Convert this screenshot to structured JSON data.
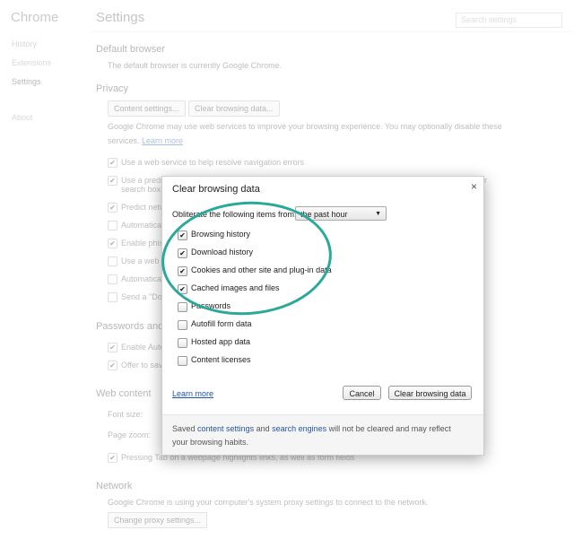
{
  "app": {
    "brand": "Chrome",
    "page_title": "Settings"
  },
  "sidebar": {
    "items": [
      {
        "label": "History"
      },
      {
        "label": "Extensions"
      },
      {
        "label": "Settings",
        "active": true
      },
      {
        "label": "About"
      }
    ]
  },
  "search": {
    "placeholder": "Search settings"
  },
  "sections": {
    "default_browser": {
      "heading": "Default browser",
      "text": "The default browser is currently Google Chrome."
    },
    "privacy": {
      "heading": "Privacy",
      "content_settings_button": "Content settings...",
      "clear_data_button": "Clear browsing data...",
      "desc_line1": "Google Chrome may use web services to improve your browsing experience. You may optionally disable these",
      "desc_line2": "services.",
      "learn_more": "Learn more",
      "options": [
        {
          "label": "Use a web service to help resolve navigation errors",
          "checked": true
        },
        {
          "label": "Use a predi",
          "label2": "search box",
          "suffix": "r",
          "checked": true
        },
        {
          "label": "Predict netw",
          "checked": true
        },
        {
          "label": "Automatica",
          "checked": false
        },
        {
          "label": "Enable phis",
          "checked": true
        },
        {
          "label": "Use a web",
          "checked": false
        },
        {
          "label": "Automatica",
          "checked": false
        },
        {
          "label": "Send a \"Do",
          "checked": false
        }
      ]
    },
    "passwords": {
      "heading": "Passwords and",
      "options": [
        {
          "label": "Enable Auto",
          "checked": true
        },
        {
          "label": "Offer to sav",
          "checked": true
        }
      ]
    },
    "web_content": {
      "heading": "Web content",
      "font_size_label": "Font size:",
      "page_zoom_label": "Page zoom:",
      "tab_option": {
        "label": "Pressing Tab on a webpage highlights links, as well as form fields",
        "checked": true
      }
    },
    "network": {
      "heading": "Network",
      "text": "Google Chrome is using your computer's system proxy settings to connect to the network.",
      "button": "Change proxy settings..."
    }
  },
  "dialog": {
    "title": "Clear browsing data",
    "close_icon": "×",
    "obliterate_label": "Obliterate the following items from:",
    "time_range": {
      "selected": "the past hour",
      "arrow": "▼"
    },
    "items": [
      {
        "label": "Browsing history",
        "checked": true
      },
      {
        "label": "Download history",
        "checked": true
      },
      {
        "label": "Cookies and other site and plug-in data",
        "checked": true
      },
      {
        "label": "Cached images and files",
        "checked": true
      },
      {
        "label": "Passwords",
        "checked": false
      },
      {
        "label": "Autofill form data",
        "checked": false
      },
      {
        "label": "Hosted app data",
        "checked": false
      },
      {
        "label": "Content licenses",
        "checked": false
      }
    ],
    "learn_more": "Learn more",
    "cancel_button": "Cancel",
    "clear_button": "Clear browsing data",
    "footer": {
      "prefix": "Saved ",
      "link1": "content settings",
      "middle": " and ",
      "link2": "search engines",
      "suffix": " will not be cleared and may reflect your browsing habits."
    }
  },
  "annotation": {
    "color": "#2aa99a",
    "shape": "ellipse"
  },
  "check_glyph": "✔"
}
